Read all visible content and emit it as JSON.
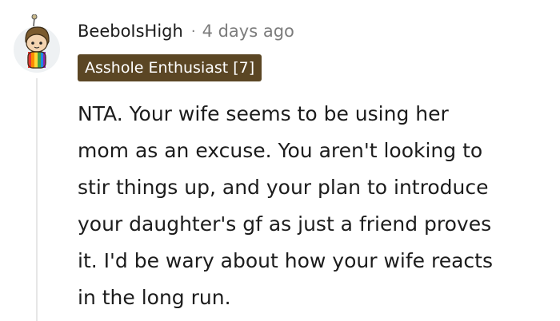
{
  "comment": {
    "username": "BeeboIsHigh",
    "separator": "·",
    "timestamp": "4 days ago",
    "flair": "Asshole Enthusiast [7]",
    "avatar_icon": "snoo-avatar-icon",
    "body_lines": [
      "NTA. Your wife seems to be using her",
      "mom as an excuse. You aren't looking to",
      "stir things up, and your plan to introduce",
      "your daughter's gf as just a friend proves",
      "it. I'd be wary about how your wife reacts",
      "in the long run."
    ]
  },
  "colors": {
    "flair_bg": "#5b4624",
    "flair_text": "#ffffff",
    "meta_text": "#7c7c7c",
    "body_text": "#1c1c1c",
    "thread_line": "#e6e6e6"
  }
}
